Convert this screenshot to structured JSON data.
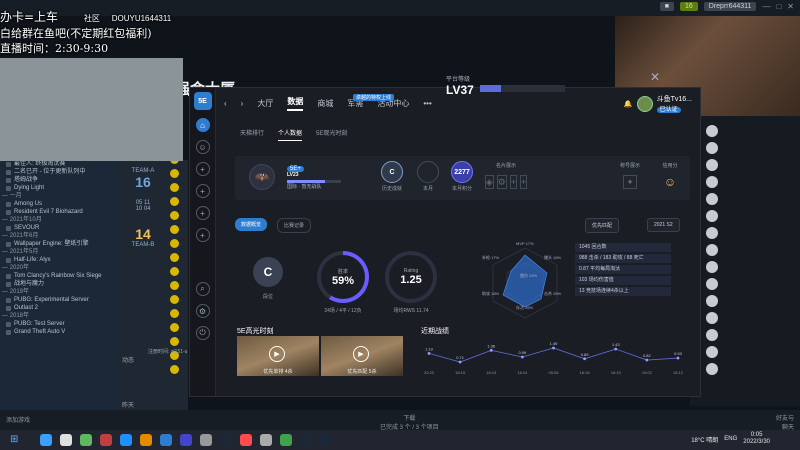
{
  "overlay": {
    "line1": "办卡=上车",
    "line1b": "社区",
    "line1c": "DOUYU1644311",
    "line2": "白给群在鱼吧(不定期红包福利)",
    "line3": "直播时间：2:30-9:30"
  },
  "steam_top": {
    "pill1": "16",
    "pill2": "Dreprr644311",
    "pill_left": "■"
  },
  "library": {
    "rows": [
      {
        "type": "item",
        "label": "最佳人: 终极淘汰赛"
      },
      {
        "type": "item",
        "label": "二名已开 - 位于更新队列中"
      },
      {
        "type": "item",
        "label": "塔姆战争"
      },
      {
        "type": "item",
        "label": "Dying Light"
      },
      {
        "type": "hdr",
        "label": "— 一月"
      },
      {
        "type": "item",
        "label": "Among Us"
      },
      {
        "type": "item",
        "label": "Resident Evil 7 Biohazard"
      },
      {
        "type": "hdr",
        "label": "— 2021年10月"
      },
      {
        "type": "item",
        "label": "SEVOUR"
      },
      {
        "type": "hdr",
        "label": "— 2021年6月"
      },
      {
        "type": "item",
        "label": "Wallpaper Engine: 壁纸引擎"
      },
      {
        "type": "hdr",
        "label": "— 2021年5月"
      },
      {
        "type": "item",
        "label": "Half-Life: Alyx"
      },
      {
        "type": "hdr",
        "label": "— 2020年"
      },
      {
        "type": "item",
        "label": "Tom Clancy's Rainbow Six Siege"
      },
      {
        "type": "item",
        "label": "战地与魔力"
      },
      {
        "type": "hdr",
        "label": "— 2019年"
      },
      {
        "type": "item",
        "label": "PUBG: Experimental Server"
      },
      {
        "type": "item",
        "label": "Outlast 2"
      },
      {
        "type": "hdr",
        "label": "— 2018年"
      },
      {
        "type": "item",
        "label": "PUBG: Test Server"
      },
      {
        "type": "item",
        "label": "Grand Theft Auto V"
      }
    ]
  },
  "teams": {
    "a_label": "TEAM-A",
    "a_score": "16",
    "b_label": "TEAM-B",
    "b_score": "14",
    "rows": [
      "05  11",
      "10  04"
    ]
  },
  "mid_text": {
    "t1": "动态",
    "t2": "注册时间: gl151-u",
    "t3": "昨天"
  },
  "game": {
    "title": "强命大厦",
    "level_caption": "平台等级",
    "level": "LV37",
    "nav": [
      "大厅",
      "数据",
      "商城",
      "军需",
      "活动中心",
      "•••"
    ],
    "nav_badge": "卓越的特权上线",
    "user": {
      "name": "斗鱼Tv16...",
      "tag": "已认证"
    },
    "subtabs": [
      "天梯排行",
      "个人数据",
      "5E观光时刻"
    ],
    "profile": {
      "level": "LV23",
      "tag": "5E+",
      "name": "国际 · 暂无战队",
      "items": [
        {
          "label": "历史成就",
          "value": "C",
          "color": "#2f3a4d"
        },
        {
          "label": "本月",
          "value": "",
          "color": "transparent"
        },
        {
          "label": "本月积分",
          "value": "2277",
          "color": "#3b3fa8"
        }
      ],
      "badge_cap": "名片展示",
      "frame_cap": "称号展示",
      "credit_cap": "信用分"
    },
    "filters": {
      "primary": "数据概览",
      "secondary": "比赛记录",
      "mode": "优先匹配",
      "season": "2021 S2"
    },
    "stats": {
      "rank": "C",
      "rank_label": "段位",
      "winrate": "59%",
      "winrate_title": "胜率",
      "winrate_cap": "24场 / 4平 / 12负",
      "rating": "1.25",
      "rating_title": "Rating",
      "rating_cap": "场均RWS 11.74",
      "radar_labels": [
        "MVP 17%",
        "爆头 16%",
        "击杀 28%",
        "存活 26%",
        "助攻 18%",
        "补枪 17%",
        "雷伤 24%"
      ],
      "list": [
        "1045 回合数",
        "988 击杀 / 183 助攻 / 88 死亡",
        "0.87 平均每局淘汰",
        "103 场均伤害值",
        "13 竞技场连续4杀以上"
      ]
    },
    "highlights": {
      "title": "5E高光时刻",
      "items": [
        {
          "label": "优先单排 4杀"
        },
        {
          "label": "优先匹配 5杀"
        }
      ]
    },
    "recent": {
      "title": "近期战绩",
      "values": [
        1.19,
        0.71,
        1.36,
        0.99,
        1.49,
        0.89,
        1.43,
        0.82,
        0.93
      ],
      "times": [
        "22:20",
        "15:15",
        "16:19",
        "16:24",
        "05:26",
        "16:16",
        "18:19",
        "10:02",
        "16:12"
      ]
    }
  },
  "steam_bottom": {
    "add": "添加游戏",
    "dl_title": "下载",
    "dl_sub": "已完成 3 个 / 3 个项目",
    "friends": "好友与\n聊天"
  },
  "taskbar": {
    "weather": "18°C 晴朗",
    "lang": "ENG",
    "time": "0:05",
    "date": "2022/3/30"
  },
  "colors": {
    "accent": "#2f7dd1",
    "win_bg": "#1a1d24",
    "steam_bg": "#1b2838"
  }
}
